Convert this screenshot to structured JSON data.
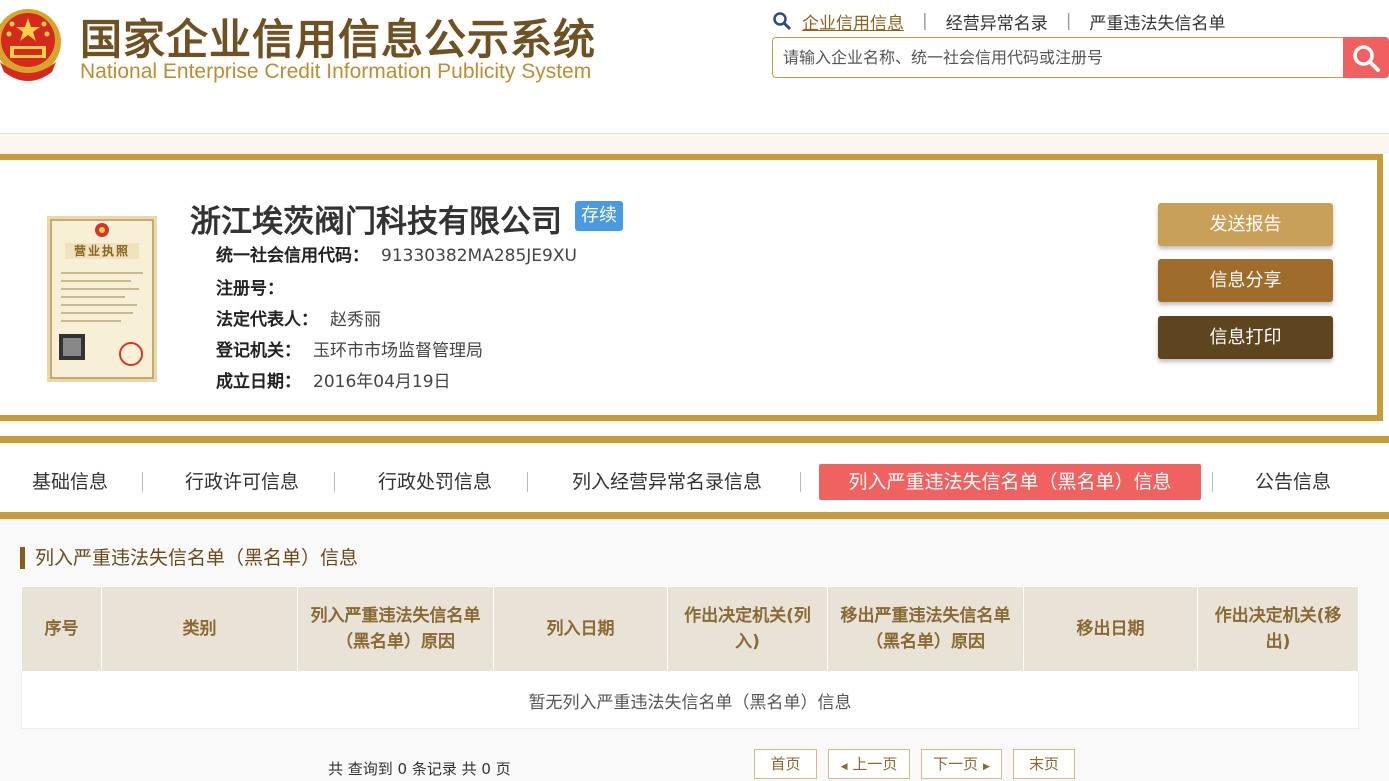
{
  "site": {
    "title": "国家企业信用信息公示系统",
    "subtitle": "National Enterprise Credit Information Publicity System"
  },
  "topnav": {
    "items": [
      "企业信用信息",
      "经营异常名录",
      "严重违法失信名单"
    ],
    "separator": "|"
  },
  "search": {
    "placeholder": "请输入企业名称、统一社会信用代码或注册号"
  },
  "company": {
    "name": "浙江埃茨阀门科技有限公司",
    "status": "存续",
    "license_label": "营业执照",
    "fields": [
      {
        "label": "统一社会信用代码：",
        "value": "91330382MA285JE9XU"
      },
      {
        "label": "注册号：",
        "value": ""
      },
      {
        "label": "法定代表人：",
        "value": "赵秀丽"
      },
      {
        "label": "登记机关：",
        "value": "玉环市市场监督管理局"
      },
      {
        "label": "成立日期：",
        "value": "2016年04月19日"
      }
    ]
  },
  "actions": {
    "send": "发送报告",
    "share": "信息分享",
    "print": "信息打印"
  },
  "tabs": [
    "基础信息",
    "行政许可信息",
    "行政处罚信息",
    "列入经营异常名录信息",
    "列入严重违法失信名单（黑名单）信息",
    "公告信息"
  ],
  "section": {
    "title": "列入严重违法失信名单（黑名单）信息"
  },
  "table": {
    "headers": [
      "序号",
      "类别",
      "列入严重违法失信名单（黑名单）原因",
      "列入日期",
      "作出决定机关(列入)",
      "移出严重违法失信名单（黑名单）原因",
      "移出日期",
      "作出决定机关(移出)"
    ],
    "empty_message": "暂无列入严重违法失信名单（黑名单）信息"
  },
  "pagination": {
    "summary": "共 查询到 0 条记录 共 0 页",
    "first": "首页",
    "prev": "上一页",
    "next": "下一页",
    "last": "末页"
  },
  "colors": {
    "brand_gold": "#c79a3a",
    "brand_brown": "#6e5224",
    "active_tab": "#f06260",
    "search_button": "#f06060",
    "status_badge": "#4a9ae0"
  }
}
